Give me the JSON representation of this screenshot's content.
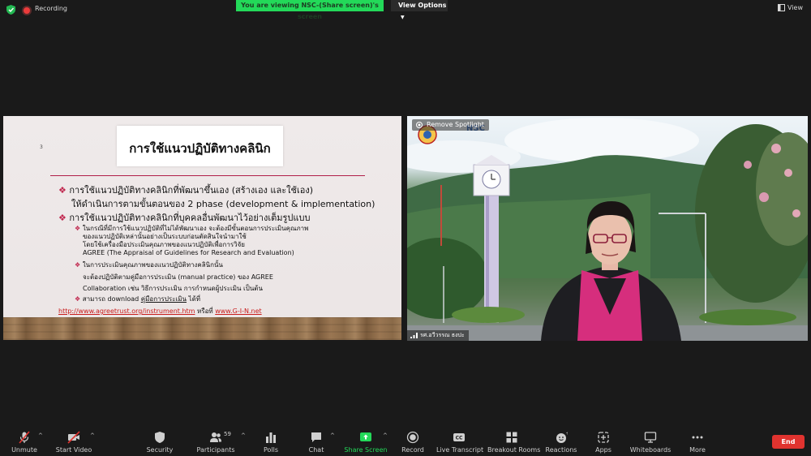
{
  "status": {
    "shield_icon": "shield-check-icon",
    "recording_label": "Recording",
    "viewing_banner": "You are viewing NSC-(Share screen)'s screen",
    "view_options_label": "View Options",
    "view_label": "View"
  },
  "slide": {
    "page_number": "3",
    "title": "การใช้แนวปฏิบัติทางคลินิก",
    "lines": [
      "การใช้แนวปฏิบัติทางคลินิกที่พัฒนาขึ้นเอง (สร้างเอง และใช้เอง)",
      "ให้ดำเนินการตามขั้นตอนของ 2 phase (development & implementation)",
      "การใช้แนวปฏิบัติทางคลินิกที่บุคคลอื่นพัฒนาไว้อย่างเต็มรูปแบบ",
      "ในกรณีที่มีการใช้แนวปฏิบัติที่ไม่ได้พัฒนาเอง จะต้องมีขั้นตอนการประเมินคุณภาพ",
      "ของแนวปฏิบัติเหล่านั้นอย่างเป็นระบบก่อนตัดสินใจนำมาใช้",
      "โดยใช้เครื่องมือประเมินคุณภาพของแนวปฏิบัติเพื่อการวิจัย",
      "AGREE (The Appraisal of Guidelines for Research and  Evaluation)",
      "ในการประเมินคุณภาพของแนวปฏิบัติทางคลินิกนั้น",
      "จะต้องปฏิบัติตามคู่มือการประเมิน (manual practice) ของ AGREE",
      "Collaboration เช่น วิธีการประเมิน การกำหนดผู้ประเมิน เป็นต้น"
    ],
    "download_prefix": "สามารถ download",
    "download_link": "คู่มือการประเมิน",
    "download_suffix": " ได้ที่",
    "url_1": "http://www.agreetrust.org/instrument.htm",
    "or_text": " หรือที่ ",
    "url_2": "www.G-I-N.net",
    "bullet_color": "#c0264d"
  },
  "video": {
    "remove_spotlight_label": "Remove Spotlight",
    "logo_text": "NSC",
    "participant_name": "รศ.อวีวรรณ ธงปะ"
  },
  "toolbar": {
    "items": [
      {
        "label": "Unmute",
        "icon": "microphone-muted-icon"
      },
      {
        "label": "Start Video",
        "icon": "video-off-icon"
      },
      {
        "label": "Security",
        "icon": "shield-icon"
      },
      {
        "label": "Participants",
        "icon": "participants-icon",
        "count": "59"
      },
      {
        "label": "Polls",
        "icon": "polls-icon"
      },
      {
        "label": "Chat",
        "icon": "chat-icon"
      },
      {
        "label": "Share Screen",
        "icon": "share-screen-icon"
      },
      {
        "label": "Record",
        "icon": "record-icon"
      },
      {
        "label": "Live Transcript",
        "icon": "cc-icon"
      },
      {
        "label": "Breakout Rooms",
        "icon": "breakout-rooms-icon"
      },
      {
        "label": "Reactions",
        "icon": "reactions-icon"
      },
      {
        "label": "Apps",
        "icon": "apps-icon"
      },
      {
        "label": "Whiteboards",
        "icon": "whiteboard-icon"
      },
      {
        "label": "More",
        "icon": "more-icon"
      }
    ],
    "end_label": "End",
    "share_accent": "#23d959",
    "end_color": "#e0332f"
  }
}
